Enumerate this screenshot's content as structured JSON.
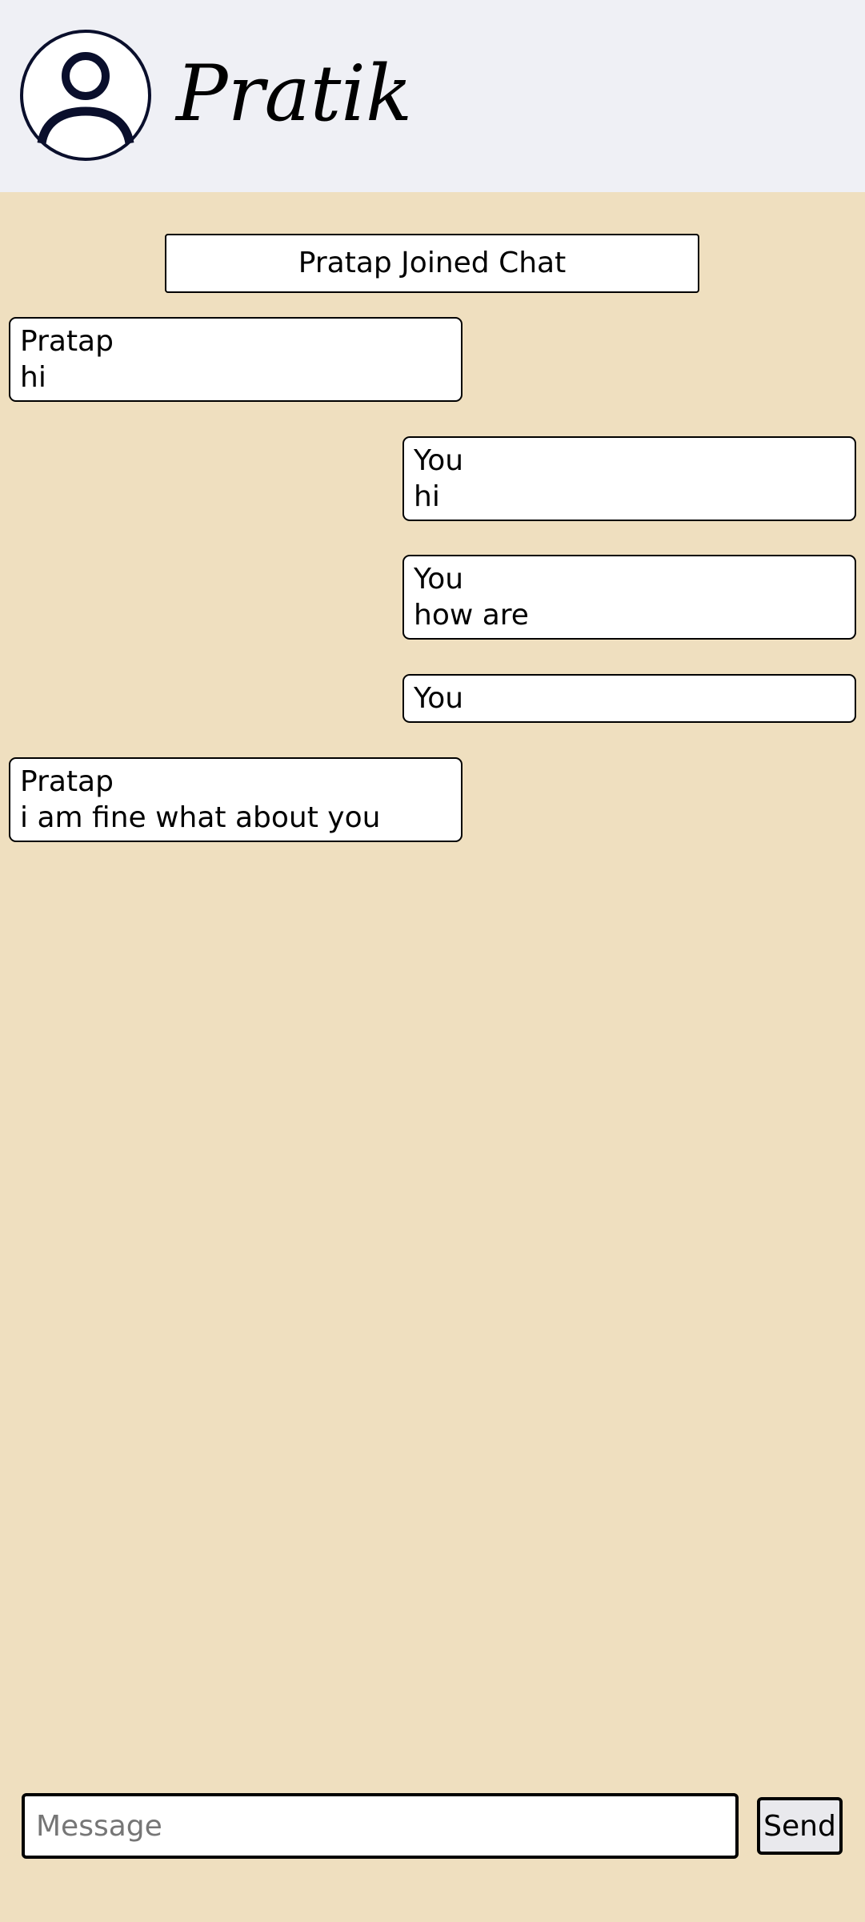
{
  "header": {
    "username": "Pratik",
    "avatar_icon": "user-circle-icon"
  },
  "chat": {
    "system_message": "Pratap Joined Chat",
    "messages": [
      {
        "side": "left",
        "sender": "Pratap",
        "text": "hi"
      },
      {
        "side": "right",
        "sender": "You",
        "text": "hi"
      },
      {
        "side": "right",
        "sender": "You",
        "text": "how are"
      },
      {
        "side": "right",
        "sender": "You",
        "text": ""
      },
      {
        "side": "left",
        "sender": "Pratap",
        "text": "i am fine what about you"
      }
    ]
  },
  "composer": {
    "placeholder": "Message",
    "value": "",
    "send_label": "Send"
  },
  "colors": {
    "header_bg": "#eff0f5",
    "chat_bg": "#efdfbf",
    "bubble_bg": "#ffffff",
    "avatar_stroke": "#0a0f2c"
  }
}
